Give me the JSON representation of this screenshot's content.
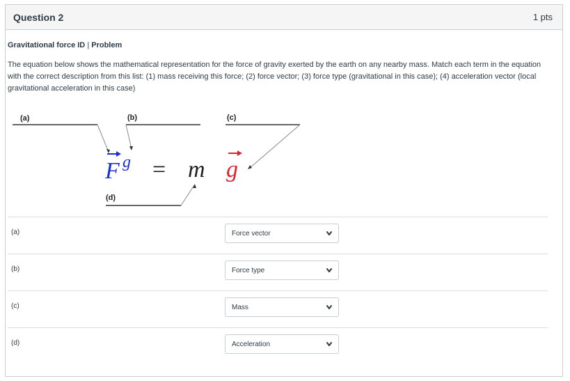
{
  "question": {
    "title": "Question 2",
    "points": "1 pts"
  },
  "problem": {
    "name": "Gravitational force ID",
    "separator": "|",
    "kind": "Problem",
    "text": "The equation below shows the mathematical representation for the force of gravity exerted by the earth on any nearby mass.  Match each term in the equation with the correct description from this list: (1) mass receiving this force; (2) force vector; (3) force type (gravitational in this case); (4) acceleration vector (local gravitational acceleration in this case)"
  },
  "diagram": {
    "labels": {
      "a": "(a)",
      "b": "(b)",
      "c": "(c)",
      "d": "(d)"
    },
    "equation": {
      "force_symbol": "F",
      "force_superscript": "g",
      "equals": "=",
      "mass_symbol": "m",
      "accel_symbol": "g"
    },
    "colors": {
      "force": "#1a2fd6",
      "accel": "#d9262f",
      "mass": "#222222",
      "leader": "#8a8a8a"
    }
  },
  "answers": [
    {
      "label": "(a)",
      "selected": "Force vector"
    },
    {
      "label": "(b)",
      "selected": "Force type"
    },
    {
      "label": "(c)",
      "selected": "Mass"
    },
    {
      "label": "(d)",
      "selected": "Acceleration"
    }
  ]
}
